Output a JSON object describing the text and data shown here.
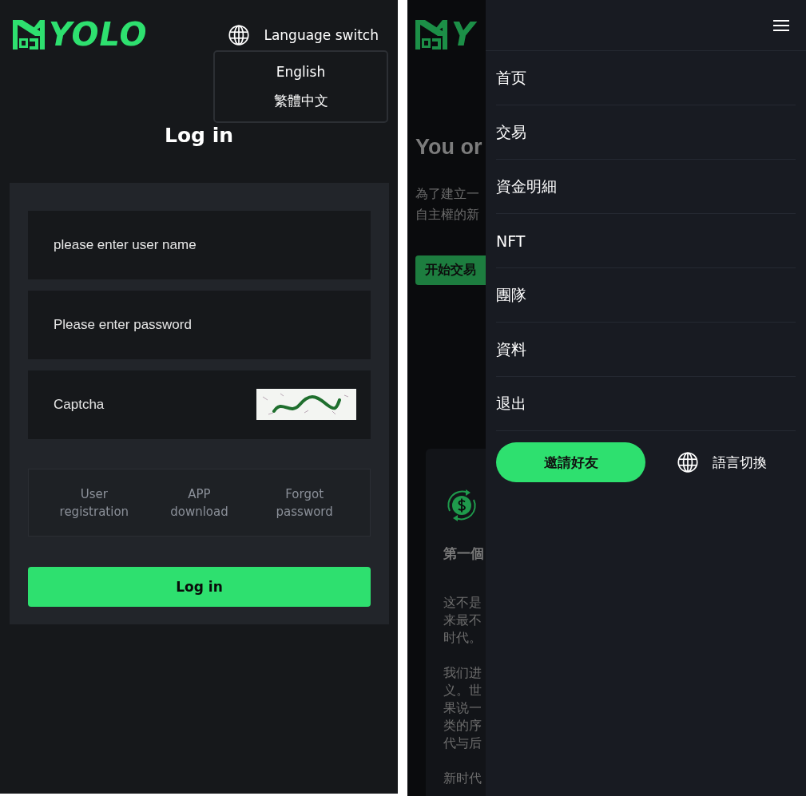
{
  "login_screen": {
    "logo": {
      "text": "YOLO"
    },
    "language_switch": {
      "label": "Language switch",
      "expanded": true,
      "options": [
        {
          "label": "English"
        },
        {
          "label": "繁體中文"
        }
      ]
    },
    "title": "Log in",
    "form": {
      "fields": [
        {
          "kind": "text",
          "placeholder": "please enter user name"
        },
        {
          "kind": "password",
          "placeholder": "Please enter password"
        },
        {
          "kind": "captcha",
          "placeholder": "Captcha"
        }
      ],
      "links": [
        "User registration",
        "APP download",
        "Forgot password"
      ],
      "submit": "Log in"
    }
  },
  "menu_screen": {
    "background_page": {
      "logo": {
        "text": "Y"
      },
      "heading": "You or",
      "intro_lines": [
        "為了建立一",
        "自主權的新"
      ],
      "start_button": "开始交易",
      "feature_card": {
        "title": "第一個",
        "paragraphs": [
          [
            "这不是",
            "来最不",
            "时代。"
          ],
          [
            "我们进",
            "义。世",
            "果说一",
            "类的序",
            "代与后"
          ],
          [
            "新时代"
          ]
        ]
      }
    },
    "drawer": {
      "menu_items": [
        {
          "label": "首页"
        },
        {
          "label": "交易"
        },
        {
          "label": "資金明細"
        },
        {
          "label": "NFT"
        },
        {
          "label": "團隊"
        },
        {
          "label": "資料"
        },
        {
          "label": "退出"
        }
      ],
      "invite_button": "邀請好友",
      "language_switch": {
        "label": "語言切換"
      }
    }
  }
}
